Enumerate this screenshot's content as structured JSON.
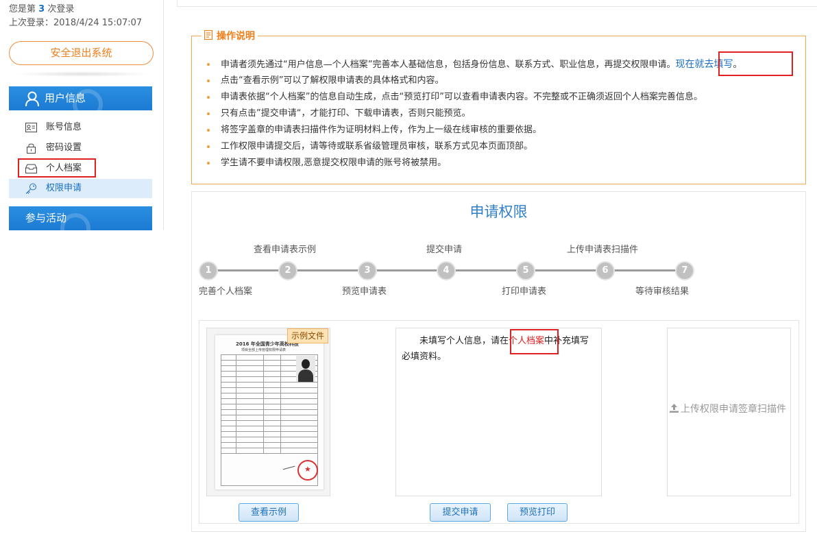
{
  "sidebar": {
    "login_count_prefix": "您是第",
    "login_count": "3",
    "login_count_suffix": "次登录",
    "last_login": "上次登录：2018/4/24 15:07:07",
    "logout_label": "安全退出系统",
    "user_section": {
      "title": "用户信息",
      "items": [
        {
          "label": "账号信息",
          "icon": "id-card-icon"
        },
        {
          "label": "密码设置",
          "icon": "lock-icon"
        },
        {
          "label": "个人档案",
          "icon": "archive-icon"
        },
        {
          "label": "权限申请",
          "icon": "key-icon",
          "active": true
        }
      ]
    },
    "activity_section": {
      "title": "参与活动"
    }
  },
  "instructions": {
    "title": "操作说明",
    "items": [
      {
        "text": "申请者须先通过“用户信息—个人档案”完善本人基础信息，包括身份信息、联系方式、职业信息，再提交权限申请。",
        "link": "现在就去填写",
        "link_suffix": "。"
      },
      {
        "text": "点击“查看示例”可以了解权限申请表的具体格式和内容。"
      },
      {
        "text": "申请表依据“个人档案”的信息自动生成，点击“预览打印”可以查看申请表内容。不完整或不正确须返回个人档案完善信息。"
      },
      {
        "text": "只有点击”提交申请“，才能打印、下载申请表，否则只能预览。"
      },
      {
        "text": "将签字盖章的申请表扫描件作为证明材料上传，作为上一级在线审核的重要依据。"
      },
      {
        "text": "工作权限申请提交后，请等待或联系省级管理员审核，联系方式见本页面顶部。"
      },
      {
        "text": "学生请不要申请权限,恶意提交权限申请的账号将被禁用。"
      }
    ]
  },
  "apply": {
    "title": "申请权限",
    "steps": [
      {
        "num": "1",
        "label": "完善个人档案",
        "pos": "bottom"
      },
      {
        "num": "2",
        "label": "查看申请表示例",
        "pos": "top"
      },
      {
        "num": "3",
        "label": "预览申请表",
        "pos": "bottom"
      },
      {
        "num": "4",
        "label": "提交申请",
        "pos": "top"
      },
      {
        "num": "5",
        "label": "打印申请表",
        "pos": "bottom"
      },
      {
        "num": "6",
        "label": "上传申请表扫描件",
        "pos": "top"
      },
      {
        "num": "7",
        "label": "等待审核结果",
        "pos": "bottom"
      }
    ],
    "sample_badge": "示例文件",
    "sample_doc_title": "2016 年全国青少年高校科技",
    "sample_doc_subtitle": "项目全部上传管理权限申请表",
    "message_before": "未填写个人信息，请在",
    "message_link": "个人档案",
    "message_after": "中补充填写必填资料。",
    "upload_label": "上传权限申请签章扫描件",
    "buttons": {
      "view_sample": "查看示例",
      "submit": "提交申请",
      "preview_print": "预览打印"
    }
  },
  "colors": {
    "primary_blue": "#1c7ad3",
    "accent_orange": "#ef7f1a",
    "highlight_red": "#e02020",
    "step_gray": "#c1c1c1"
  }
}
